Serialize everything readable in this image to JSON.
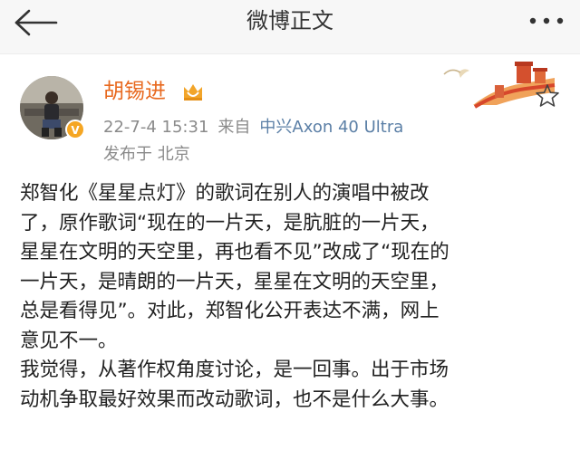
{
  "header": {
    "title": "微博正文",
    "back_icon": "back-arrow-icon",
    "more_icon": "more-dots-icon"
  },
  "author": {
    "name": "胡锡进",
    "verified_icon": "verified-badge-icon",
    "badge_icon": "vip-crown-icon",
    "date_time": "22-7-4 15:31",
    "source_prefix": "来自",
    "source_device": "中兴Axon 40 Ultra",
    "location": "发布于 北京"
  },
  "decoration": {
    "card_art_icon": "great-wall-icon",
    "favorite_icon": "star-icon"
  },
  "post": {
    "lines": [
      "郑智化《星星点灯》的歌词在别人的演唱中被改",
      "了，原作歌词“现在的一片天，是肮脏的一片天，",
      "星星在文明的天空里，再也看不见”改成了“现在的",
      "一片天，是晴朗的一片天，星星在文明的天空里，",
      "总是看得见”。对此，郑智化公开表达不满，网上",
      "意见不一。",
      "我觉得，从著作权角度讨论，是一回事。出于市场",
      "动机争取最好效果而改动歌词，也不是什么大事。"
    ]
  },
  "colors": {
    "username": "#e8691f",
    "source_link": "#5b7fa6",
    "meta_text": "#8a8a8a",
    "topbar_bg": "#f7f7f7"
  }
}
